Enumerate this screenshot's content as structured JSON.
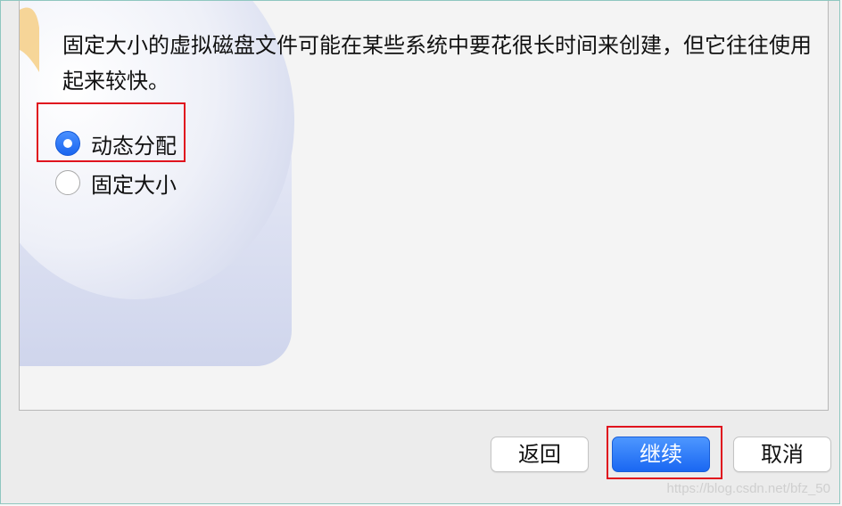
{
  "dialog": {
    "description": "固定大小的虚拟磁盘文件可能在某些系统中要花很长时间来创建，但它往往使用起来较快。",
    "options": [
      {
        "label": "动态分配",
        "selected": true
      },
      {
        "label": "固定大小",
        "selected": false
      }
    ]
  },
  "buttons": {
    "back_label": "返回",
    "continue_label": "继续",
    "cancel_label": "取消"
  },
  "watermark": "https://blog.csdn.net/bfz_50",
  "colors": {
    "accent": "#1a67f2",
    "highlight": "#e0141e",
    "frame_border": "#8fc7c0"
  }
}
